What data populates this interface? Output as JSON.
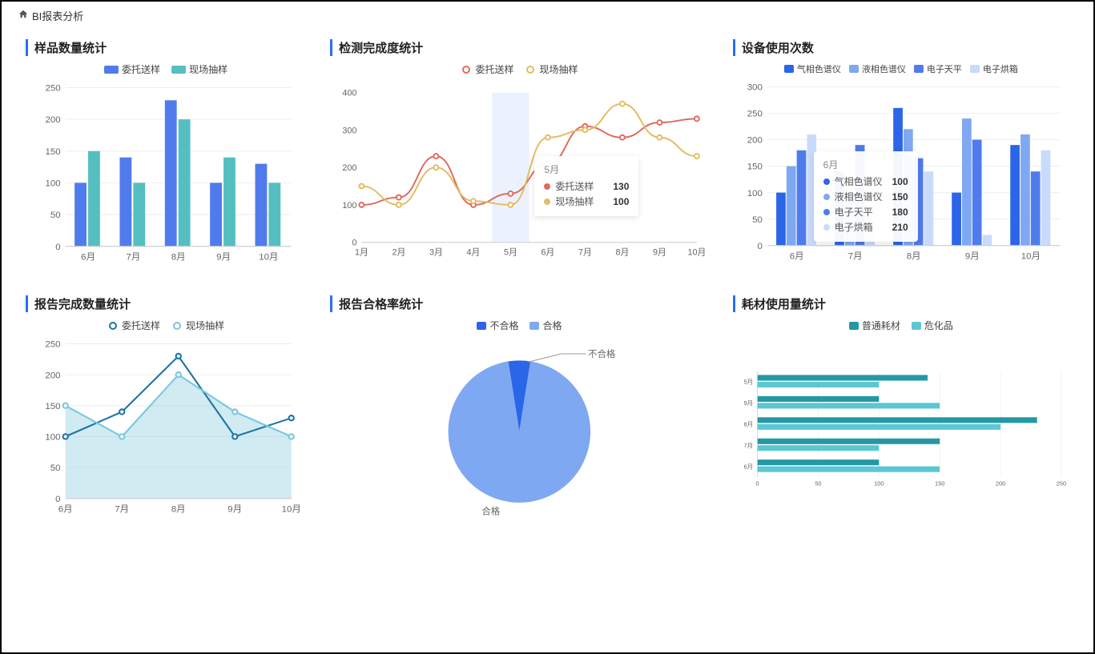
{
  "breadcrumb": {
    "title": "BI报表分析"
  },
  "chart_data": [
    {
      "id": "samples",
      "title": "样品数量统计",
      "type": "bar",
      "categories": [
        "6月",
        "7月",
        "8月",
        "9月",
        "10月"
      ],
      "series": [
        {
          "name": "委托送样",
          "values": [
            100,
            140,
            230,
            100,
            130
          ],
          "color": "#4f7bed"
        },
        {
          "name": "现场抽样",
          "values": [
            150,
            100,
            200,
            140,
            100
          ],
          "color": "#55bfc0"
        }
      ],
      "ylim": [
        0,
        250
      ],
      "ystep": 50
    },
    {
      "id": "completion",
      "title": "检测完成度统计",
      "type": "line-smooth",
      "categories": [
        "1月",
        "2月",
        "3月",
        "4月",
        "5月",
        "6月",
        "7月",
        "8月",
        "9月",
        "10月"
      ],
      "series": [
        {
          "name": "委托送样",
          "values": [
            100,
            120,
            230,
            100,
            130,
            210,
            310,
            280,
            320,
            330
          ],
          "color": "#e06a5f"
        },
        {
          "name": "现场抽样",
          "values": [
            150,
            100,
            200,
            110,
            100,
            280,
            300,
            370,
            280,
            230
          ],
          "color": "#e2bd63"
        }
      ],
      "ylim": [
        0,
        400
      ],
      "ystep": 100,
      "tooltip": {
        "x": "5月",
        "rows": [
          {
            "label": "委托送样",
            "value": 130,
            "color": "#e06a5f"
          },
          {
            "label": "现场抽样",
            "value": 100,
            "color": "#e2bd63"
          }
        ]
      }
    },
    {
      "id": "equipment",
      "title": "设备使用次数",
      "type": "bar",
      "categories": [
        "6月",
        "7月",
        "8月",
        "9月",
        "10月"
      ],
      "series": [
        {
          "name": "气相色谱仪",
          "values": [
            100,
            140,
            260,
            100,
            190
          ],
          "color": "#2b66e8"
        },
        {
          "name": "液相色谱仪",
          "values": [
            150,
            100,
            220,
            240,
            210
          ],
          "color": "#7fa8f2"
        },
        {
          "name": "电子天平",
          "values": [
            180,
            190,
            165,
            200,
            140
          ],
          "color": "#4f7bed"
        },
        {
          "name": "电子烘箱",
          "values": [
            210,
            80,
            140,
            20,
            180
          ],
          "color": "#c9dbfb"
        }
      ],
      "ylim": [
        0,
        300
      ],
      "ystep": 50,
      "tooltip": {
        "x": "6月",
        "rows": [
          {
            "label": "气相色谱仪",
            "value": 100,
            "color": "#2b66e8"
          },
          {
            "label": "液相色谱仪",
            "value": 150,
            "color": "#7fa8f2"
          },
          {
            "label": "电子天平",
            "value": 180,
            "color": "#4f7bed"
          },
          {
            "label": "电子烘箱",
            "value": 210,
            "color": "#c9dbfb"
          }
        ]
      }
    },
    {
      "id": "reports",
      "title": "报告完成数量统计",
      "type": "area-line",
      "categories": [
        "6月",
        "7月",
        "8月",
        "9月",
        "10月"
      ],
      "series": [
        {
          "name": "委托送样",
          "values": [
            100,
            140,
            230,
            100,
            130
          ],
          "color": "#1e74a3",
          "fill": "none"
        },
        {
          "name": "现场抽样",
          "values": [
            150,
            100,
            200,
            140,
            100
          ],
          "color": "#7ac7dd",
          "fill": "rgba(122,199,221,0.35)"
        }
      ],
      "ylim": [
        0,
        250
      ],
      "ystep": 50
    },
    {
      "id": "passrate",
      "title": "报告合格率统计",
      "type": "pie",
      "series": [
        {
          "name": "不合格",
          "value": 5,
          "color": "#2b66e8"
        },
        {
          "name": "合格",
          "value": 95,
          "color": "#7fa8f2"
        }
      ],
      "labels": {
        "top": "不合格",
        "bottom": "合格"
      },
      "legend": [
        {
          "name": "不合格",
          "color": "#2b66e8"
        },
        {
          "name": "合格",
          "color": "#7fa8f2"
        }
      ]
    },
    {
      "id": "consumables",
      "title": "耗材使用量统计",
      "type": "bar-horizontal",
      "categories": [
        "5月",
        "9月",
        "8月",
        "7月",
        "6月"
      ],
      "series": [
        {
          "name": "普通耗材",
          "values": [
            140,
            100,
            230,
            150,
            100
          ],
          "color": "#2498a4"
        },
        {
          "name": "危化品",
          "values": [
            100,
            150,
            200,
            100,
            150
          ],
          "color": "#5bc7d3"
        }
      ],
      "xlim": [
        0,
        250
      ],
      "xstep": 50
    }
  ]
}
